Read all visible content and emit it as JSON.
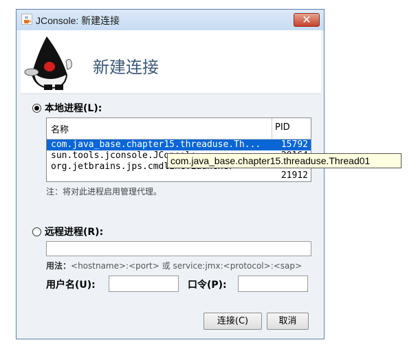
{
  "window": {
    "title": "JConsole: 新建连接",
    "close_glyph": "✕",
    "app_icon": "java-cup-icon"
  },
  "banner": {
    "title": "新建连接",
    "mascot": "duke-mascot"
  },
  "local": {
    "label": "本地进程(L):",
    "selected": true,
    "table": {
      "columns": [
        "名称",
        "PID"
      ],
      "rows": [
        {
          "name": "com.java_base.chapter15.threaduse.Th...",
          "pid": "15792",
          "selected": true
        },
        {
          "name": "sun.tools.jconsole.JConsole",
          "pid": "20164",
          "selected": false
        },
        {
          "name": "org.jetbrains.jps.cmdline.Launcher",
          "pid": "",
          "selected": false
        },
        {
          "name": "",
          "pid": "21912",
          "selected": false
        }
      ]
    },
    "tooltip": "com.java_base.chapter15.threaduse.Thread01",
    "note": "注：将对此进程启用管理代理。"
  },
  "remote": {
    "label": "远程进程(R):",
    "selected": false,
    "value": "",
    "usage_prefix": "用法：",
    "usage_text": "<hostname>:<port> 或 service:jmx:<protocol>:<sap>"
  },
  "credentials": {
    "username_label": "用户名(U):",
    "username_value": "",
    "password_label": "口令(P):",
    "password_value": ""
  },
  "buttons": {
    "connect": "连接(C)",
    "cancel": "取消"
  }
}
